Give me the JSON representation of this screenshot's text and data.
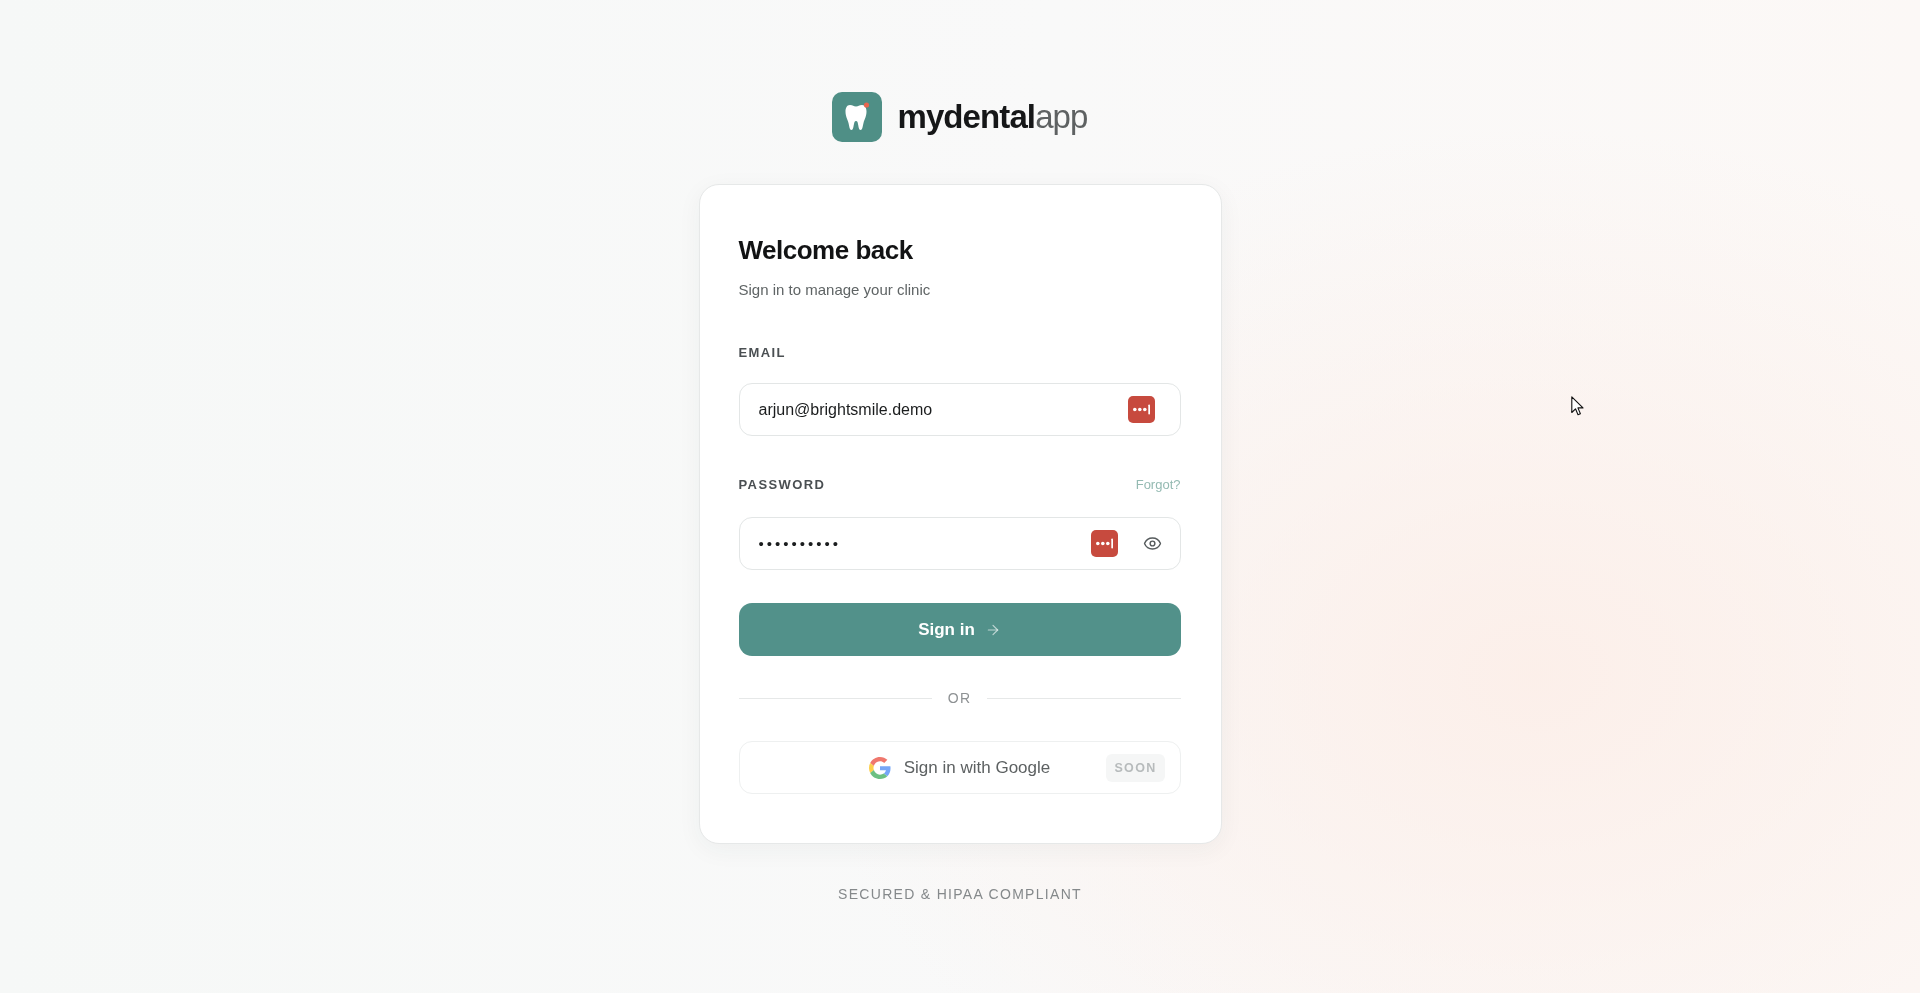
{
  "brand": {
    "name": "**mydental**app"
  },
  "card": {
    "title": "Welcome back",
    "subtitle": "Sign in to manage your clinic",
    "fields": [
      {
        "kind": "email",
        "label": "EMAIL",
        "value": "arjun@brightsmile.demo"
      },
      {
        "kind": "password",
        "label": "PASSWORD",
        "link": "Forgot?",
        "value": "••••••••••"
      }
    ],
    "submit": {
      "label": "Sign in"
    },
    "divider": "OR",
    "social": {
      "label": "Sign in with Google",
      "badge": "SOON",
      "disabled": true
    }
  },
  "footer": "SECURED & HIPAA COMPLIANT"
}
